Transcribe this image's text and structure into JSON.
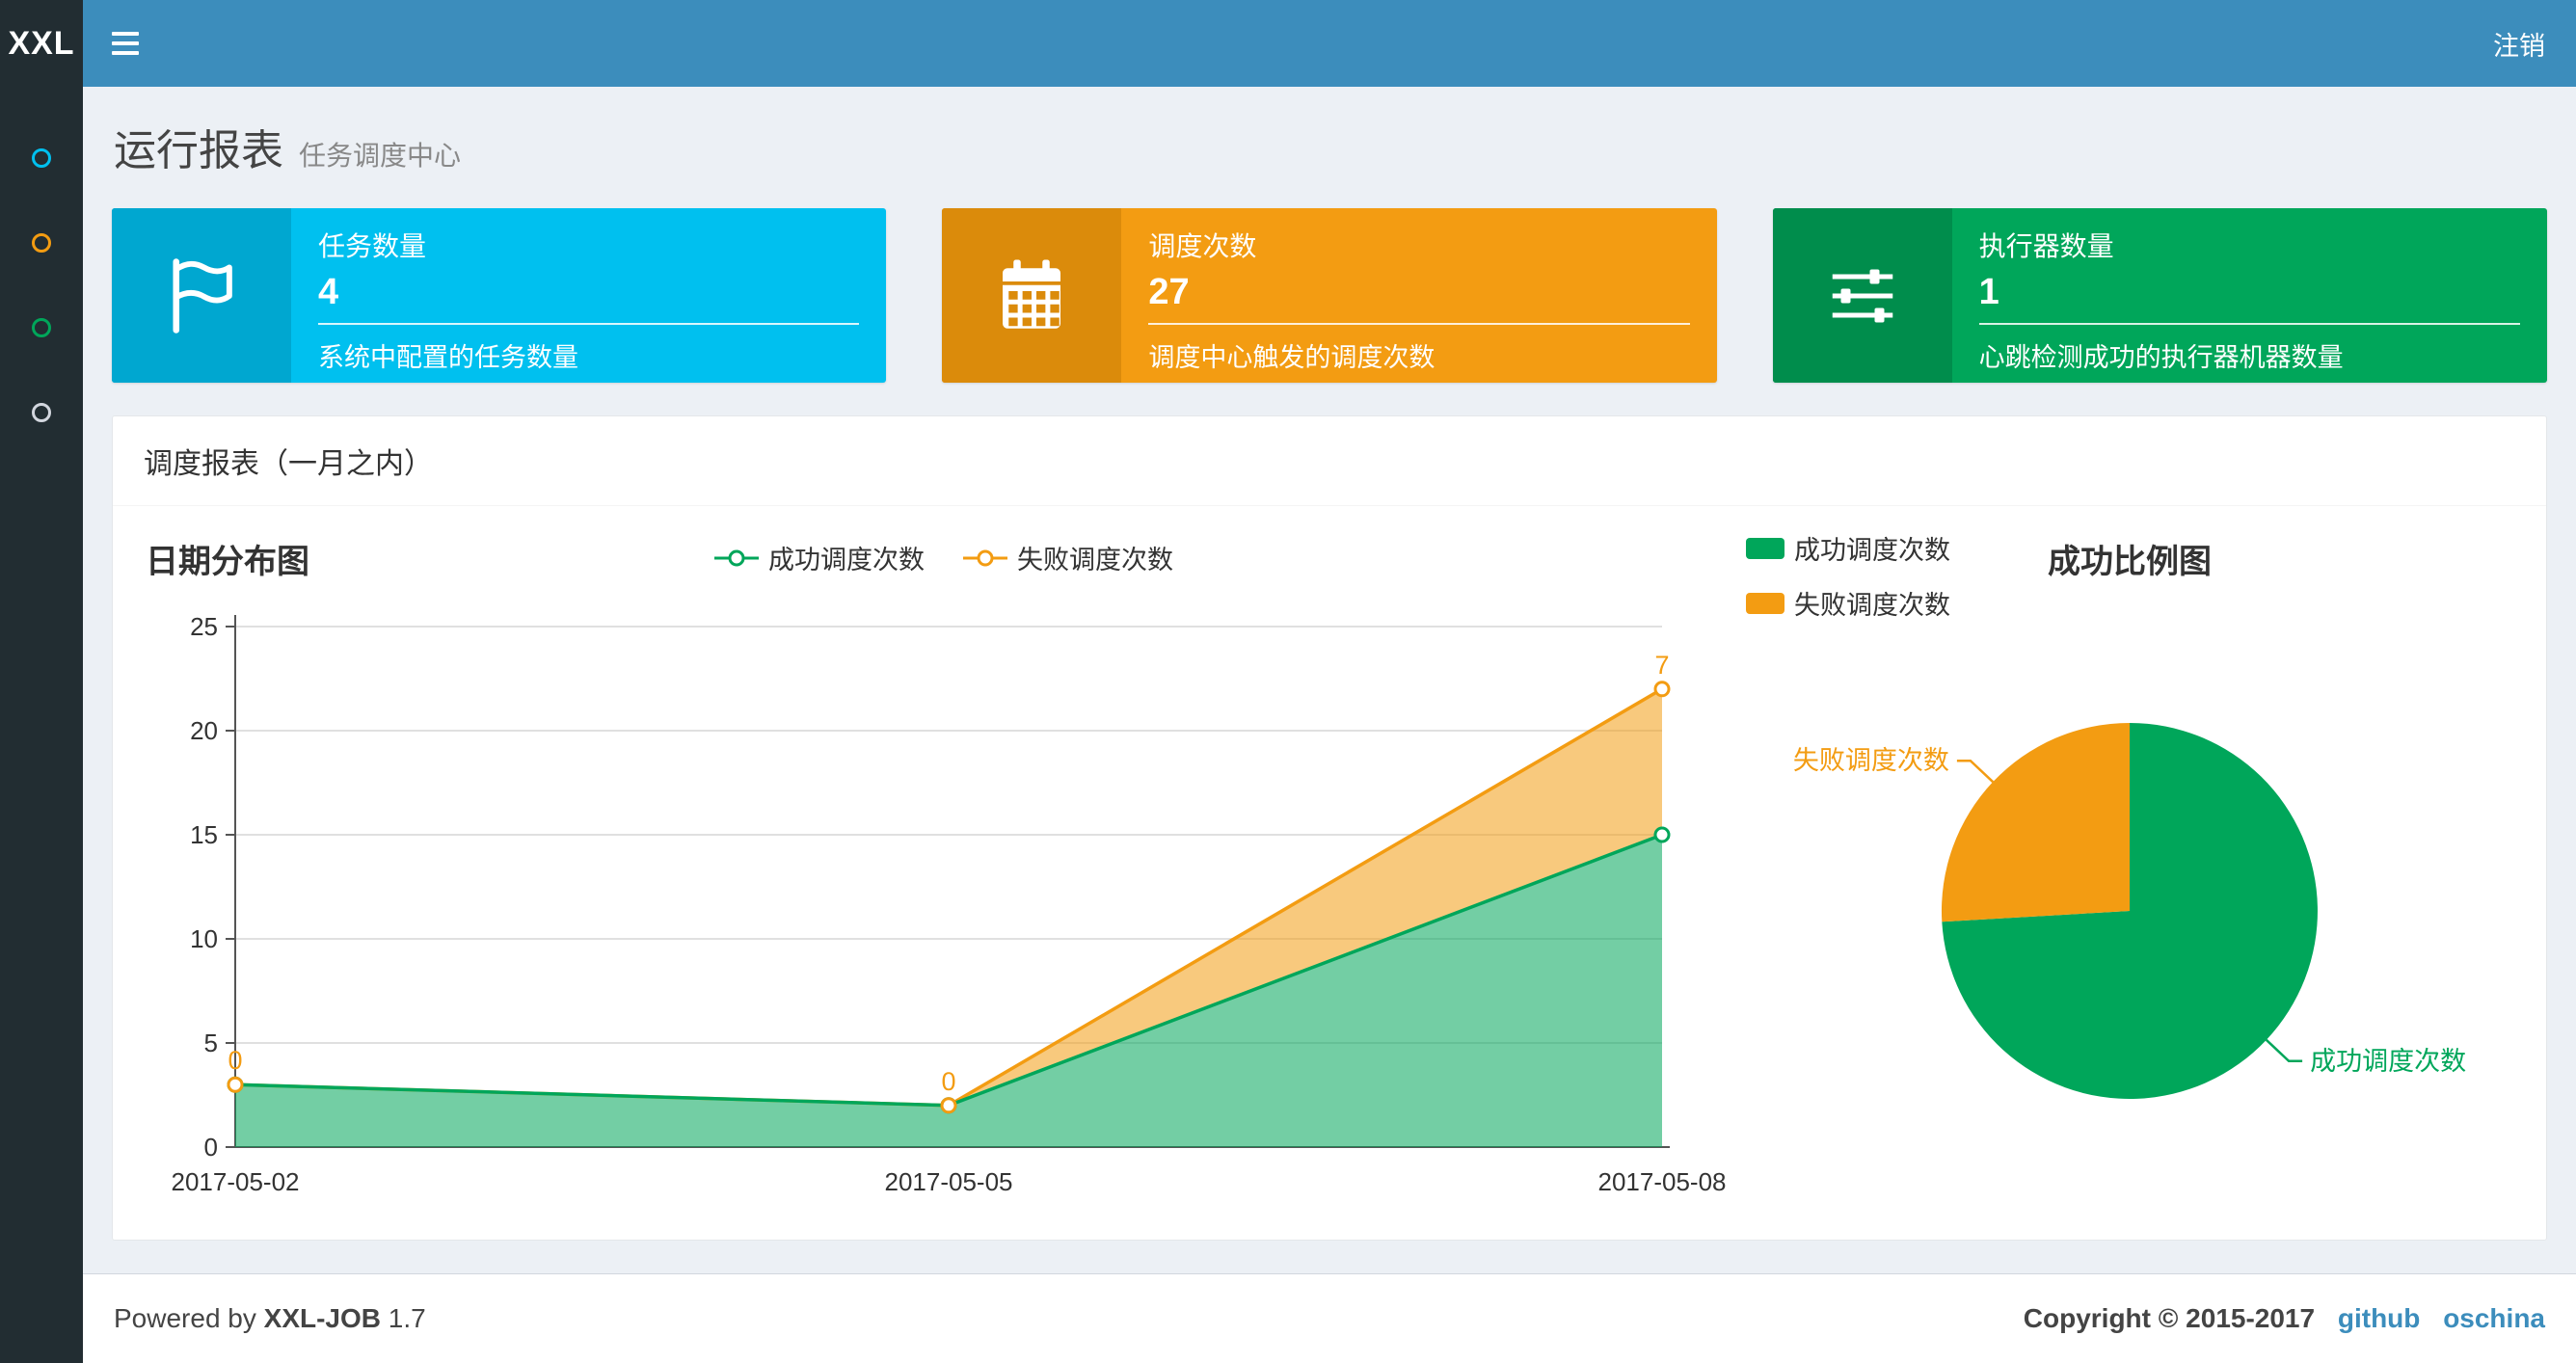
{
  "navbar": {
    "logo": "XXL",
    "logout_label": "注销"
  },
  "sidebar": {
    "items": [
      {
        "icon": "circle-icon",
        "color": "#00c0ef"
      },
      {
        "icon": "circle-icon",
        "color": "#f39c12"
      },
      {
        "icon": "circle-icon",
        "color": "#00a65a"
      },
      {
        "icon": "circle-icon",
        "color": "#d2d6de"
      }
    ]
  },
  "page_header": {
    "title": "运行报表",
    "subtitle": "任务调度中心"
  },
  "info_boxes": [
    {
      "icon": "flag-icon",
      "title": "任务数量",
      "value": "4",
      "desc": "系统中配置的任务数量",
      "color": "#00c0ef",
      "icon_bg": "#00a7d0"
    },
    {
      "icon": "calendar-icon",
      "title": "调度次数",
      "value": "27",
      "desc": "调度中心触发的调度次数",
      "color": "#f39c12",
      "icon_bg": "#db8b0b"
    },
    {
      "icon": "sliders-icon",
      "title": "执行器数量",
      "value": "1",
      "desc": "心跳检测成功的执行器机器数量",
      "color": "#00a65a",
      "icon_bg": "#008d4c"
    }
  ],
  "panel": {
    "title": "调度报表（一月之内）"
  },
  "chart_data": [
    {
      "type": "area",
      "title": "日期分布图",
      "x": [
        "2017-05-02",
        "2017-05-05",
        "2017-05-08"
      ],
      "series": [
        {
          "name": "成功调度次数",
          "color": "#00a65a",
          "values": [
            3,
            2,
            15
          ]
        },
        {
          "name": "失败调度次数",
          "color": "#f39c12",
          "values": [
            0,
            0,
            7
          ],
          "labels": [
            "0",
            "0",
            "7"
          ]
        }
      ],
      "stacked": true,
      "ylim": [
        0,
        25
      ],
      "yticks": [
        0,
        5,
        10,
        15,
        20,
        25
      ],
      "grid": true,
      "legend_position": "top-center"
    },
    {
      "type": "pie",
      "title": "成功比例图",
      "slices": [
        {
          "name": "成功调度次数",
          "value": 20,
          "color": "#00a65a"
        },
        {
          "name": "失败调度次数",
          "value": 7,
          "color": "#f39c12"
        }
      ],
      "legend_position": "top-left"
    }
  ],
  "footer": {
    "powered_by": "Powered by",
    "product": "XXL-JOB",
    "version": "1.7",
    "copyright": "Copyright © 2015-2017",
    "links": [
      "github",
      "oschina"
    ]
  }
}
